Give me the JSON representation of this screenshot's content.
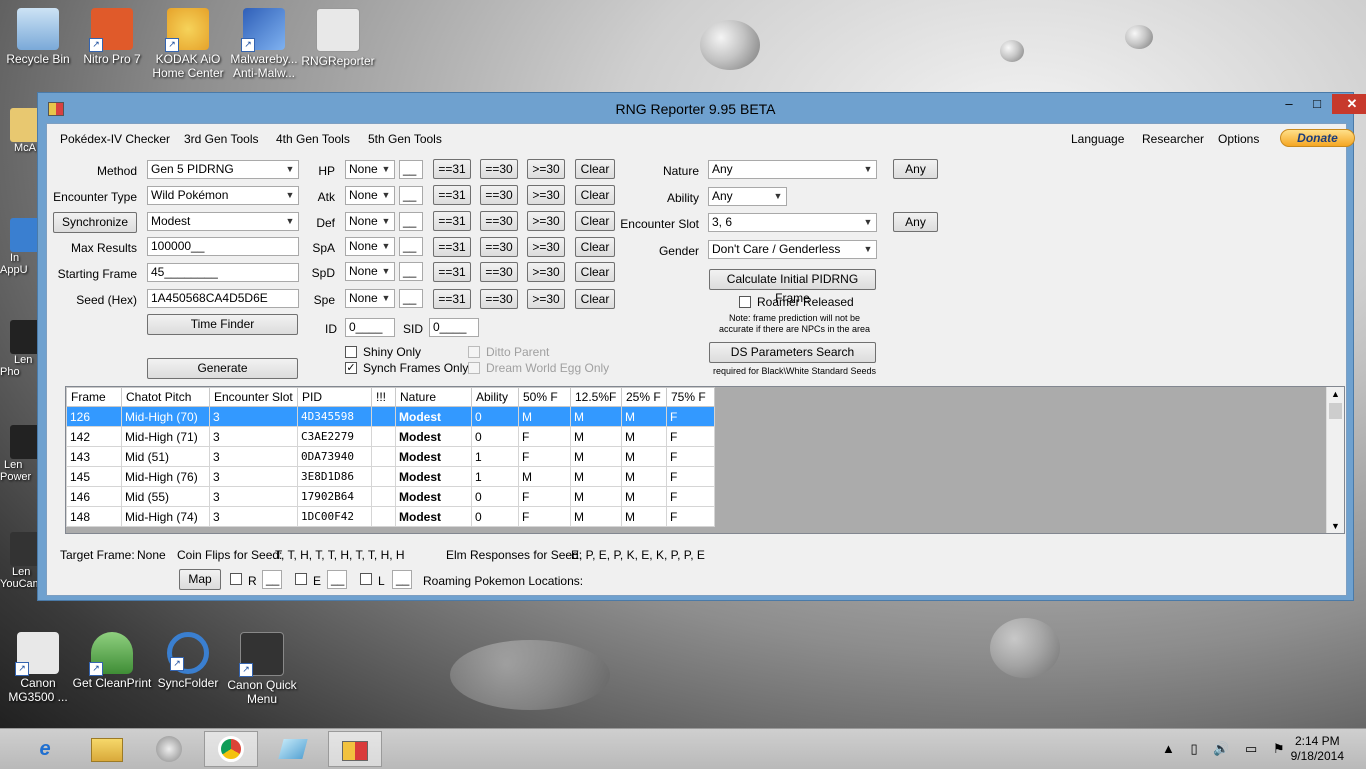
{
  "desktop": {
    "icons_top": [
      {
        "label": "Recycle Bin",
        "color": "#7aa9d8"
      },
      {
        "label": "Nitro Pro 7",
        "color": "#e05a2a"
      },
      {
        "label": "KODAK AiO Home Center",
        "color": "#f2c84b"
      },
      {
        "label": "Malwareby... Anti-Malw...",
        "color": "#2f5fb8"
      },
      {
        "label": "RNGReporter",
        "color": "#e8e8e8"
      }
    ],
    "icons_left": [
      "McA",
      "In AppU",
      "Len Pho",
      "Len Power",
      "Len YouCam"
    ],
    "icons_bottom": [
      {
        "label": "Canon MG3500 ...",
        "color": "#e8e8e8"
      },
      {
        "label": "Get CleanPrint",
        "color": "#57a34b"
      },
      {
        "label": "SyncFolder",
        "color": "#3a7fd0"
      },
      {
        "label": "Canon Quick Menu",
        "color": "#333333"
      }
    ]
  },
  "window": {
    "title": "RNG Reporter 9.95 BETA",
    "min": "–",
    "max": "□",
    "close": "✕"
  },
  "menu": {
    "left": [
      "Pokédex-IV Checker",
      "3rd Gen Tools",
      "4th Gen Tools",
      "5th Gen Tools"
    ],
    "right": [
      "Language",
      "Researcher",
      "Options"
    ],
    "donate": "Donate"
  },
  "form": {
    "method_label": "Method",
    "method": "Gen 5 PIDRNG",
    "encounter_label": "Encounter Type",
    "encounter": "Wild Pokémon",
    "sync_button": "Synchronize",
    "sync_nature": "Modest",
    "max_results_label": "Max Results",
    "max_results": "100000__",
    "starting_frame_label": "Starting Frame",
    "starting_frame": "45________",
    "seed_label": "Seed (Hex)",
    "seed": "1A450568CA4D5D6E",
    "time_finder": "Time Finder",
    "generate": "Generate"
  },
  "stats": {
    "rows": [
      {
        "label": "HP",
        "value": "None",
        "field": "__"
      },
      {
        "label": "Atk",
        "value": "None",
        "field": "__"
      },
      {
        "label": "Def",
        "value": "None",
        "field": "__"
      },
      {
        "label": "SpA",
        "value": "None",
        "field": "__"
      },
      {
        "label": "SpD",
        "value": "None",
        "field": "__"
      },
      {
        "label": "Spe",
        "value": "None",
        "field": "__"
      }
    ],
    "btn31": "==31",
    "btn30": "==30",
    "btnge30": ">=30",
    "clear": "Clear",
    "id_label": "ID",
    "id_value": "0____",
    "sid_label": "SID",
    "sid_value": "0____",
    "shiny_only": "Shiny Only",
    "synch_only": "Synch Frames Only",
    "ditto_parent": "Ditto Parent",
    "dream_world": "Dream World Egg Only"
  },
  "right_panel": {
    "nature_label": "Nature",
    "nature": "Any",
    "nature_any": "Any",
    "ability_label": "Ability",
    "ability": "Any",
    "slot_label": "Encounter Slot",
    "slot": "3, 6",
    "slot_any": "Any",
    "gender_label": "Gender",
    "gender": "Don't Care / Genderless",
    "calc_button": "Calculate Initial PIDRNG Frame",
    "roamer": "Roamer Released",
    "note1": "Note: frame prediction will not be",
    "note2": "accurate if there are NPCs in the area",
    "ds_button": "DS Parameters Search",
    "ds_note": "required for Black\\White Standard Seeds"
  },
  "results": {
    "headers": [
      "Frame",
      "Chatot Pitch",
      "Encounter Slot",
      "PID",
      "!!!",
      "Nature",
      "Ability",
      "50% F",
      "12.5%F",
      "25% F",
      "75% F"
    ],
    "rows": [
      [
        "126",
        "Mid-High (70)",
        "3",
        "4D345598",
        "",
        "Modest",
        "0",
        "M",
        "M",
        "M",
        "F"
      ],
      [
        "142",
        "Mid-High (71)",
        "3",
        "C3AE2279",
        "",
        "Modest",
        "0",
        "F",
        "M",
        "M",
        "F"
      ],
      [
        "143",
        "Mid (51)",
        "3",
        "0DA73940",
        "",
        "Modest",
        "1",
        "F",
        "M",
        "M",
        "F"
      ],
      [
        "145",
        "Mid-High (76)",
        "3",
        "3E8D1D86",
        "",
        "Modest",
        "1",
        "M",
        "M",
        "M",
        "F"
      ],
      [
        "146",
        "Mid (55)",
        "3",
        "17902B64",
        "",
        "Modest",
        "0",
        "F",
        "M",
        "M",
        "F"
      ],
      [
        "148",
        "Mid-High (74)",
        "3",
        "1DC00F42",
        "",
        "Modest",
        "0",
        "F",
        "M",
        "M",
        "F"
      ]
    ],
    "selection_color": "#3399ff"
  },
  "footer": {
    "target_label": "Target Frame:",
    "target_value": "None",
    "coin_label": "Coin Flips for Seed:",
    "coin_value": "T, T, H, T, T, H, T, T, H, H",
    "elm_label": "Elm Responses for Seed:",
    "elm_value": "E, P, E, P, K, E, K, P, P, E",
    "map_button": "Map",
    "r_label": "R",
    "e_label": "E",
    "l_label": "L",
    "field": "__",
    "roaming_label": "Roaming Pokemon Locations:"
  },
  "taskbar": {
    "time": "2:14 PM",
    "date": "9/18/2014"
  }
}
